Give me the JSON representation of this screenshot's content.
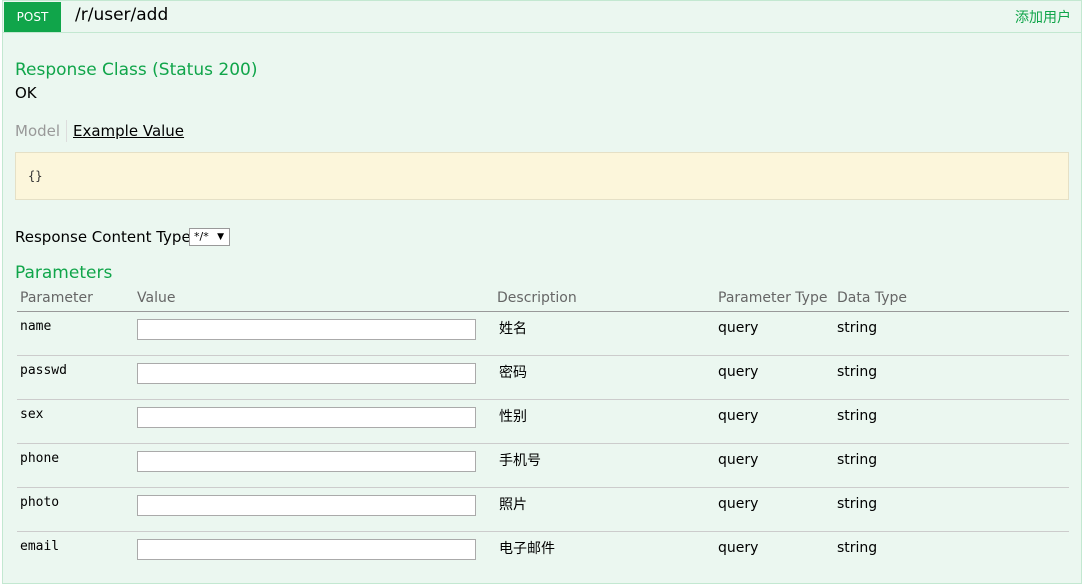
{
  "endpoint": {
    "method": "POST",
    "path": "/r/user/add",
    "summary": "添加用户"
  },
  "response_class": {
    "title": "Response Class (Status 200)",
    "status_text": "OK",
    "tabs": {
      "model": "Model",
      "example": "Example Value"
    },
    "example_value": "{}"
  },
  "response_content_type": {
    "label": "Response Content Type",
    "selected": "*/*"
  },
  "parameters": {
    "title": "Parameters",
    "columns": [
      "Parameter",
      "Value",
      "Description",
      "Parameter Type",
      "Data Type"
    ],
    "rows": [
      {
        "name": "name",
        "value": "",
        "description": "姓名",
        "param_type": "query",
        "data_type": "string"
      },
      {
        "name": "passwd",
        "value": "",
        "description": "密码",
        "param_type": "query",
        "data_type": "string"
      },
      {
        "name": "sex",
        "value": "",
        "description": "性别",
        "param_type": "query",
        "data_type": "string"
      },
      {
        "name": "phone",
        "value": "",
        "description": "手机号",
        "param_type": "query",
        "data_type": "string"
      },
      {
        "name": "photo",
        "value": "",
        "description": "照片",
        "param_type": "query",
        "data_type": "string"
      },
      {
        "name": "email",
        "value": "",
        "description": "电子邮件",
        "param_type": "query",
        "data_type": "string"
      }
    ]
  },
  "colors": {
    "accent": "#10a54a",
    "panel_bg": "#ebf7f0",
    "example_bg": "#fcf6db"
  }
}
